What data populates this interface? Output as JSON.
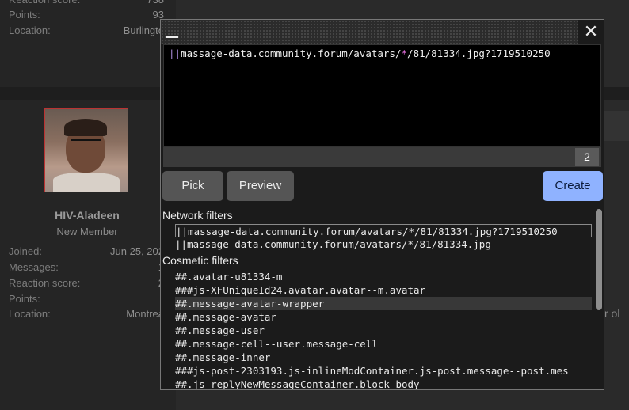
{
  "background": {
    "top_kv": [
      {
        "key": "Reaction score:",
        "value": "738"
      },
      {
        "key": "Points:",
        "value": "93"
      },
      {
        "key": "Location:",
        "value": "Burlingto"
      }
    ],
    "user": {
      "name": "HIV-Aladeen",
      "title": "New Member",
      "stats": [
        {
          "key": "Joined:",
          "value": "Jun 25, 202"
        },
        {
          "key": "Messages:",
          "value": "1"
        },
        {
          "key": "Reaction score:",
          "value": "2"
        },
        {
          "key": "Points:",
          "value": ""
        },
        {
          "key": "Location:",
          "value": "Montrea"
        }
      ]
    },
    "right_text": "yr ol"
  },
  "popup": {
    "close_glyph": "✕",
    "editor": {
      "prefix": "||",
      "part1": "massage-data.community.forum/avatars/",
      "wildcard": "*",
      "part2": "/81/81334.jpg?1719510250"
    },
    "count": "2",
    "buttons": {
      "pick": "Pick",
      "preview": "Preview",
      "create": "Create"
    },
    "network_header": "Network filters",
    "network_filters": [
      "||massage-data.community.forum/avatars/*/81/81334.jpg?1719510250",
      "||massage-data.community.forum/avatars/*/81/81334.jpg"
    ],
    "cosmetic_header": "Cosmetic filters",
    "cosmetic_filters": [
      "##.avatar-u81334-m",
      "###js-XFUniqueId24.avatar.avatar--m.avatar",
      "##.message-avatar-wrapper",
      "##.message-avatar",
      "##.message-user",
      "##.message-cell--user.message-cell",
      "##.message-inner",
      "###js-post-2303193.js-inlineModContainer.js-post.message--post.mes",
      "##.js-replyNewMessageContainer.block-body"
    ]
  }
}
